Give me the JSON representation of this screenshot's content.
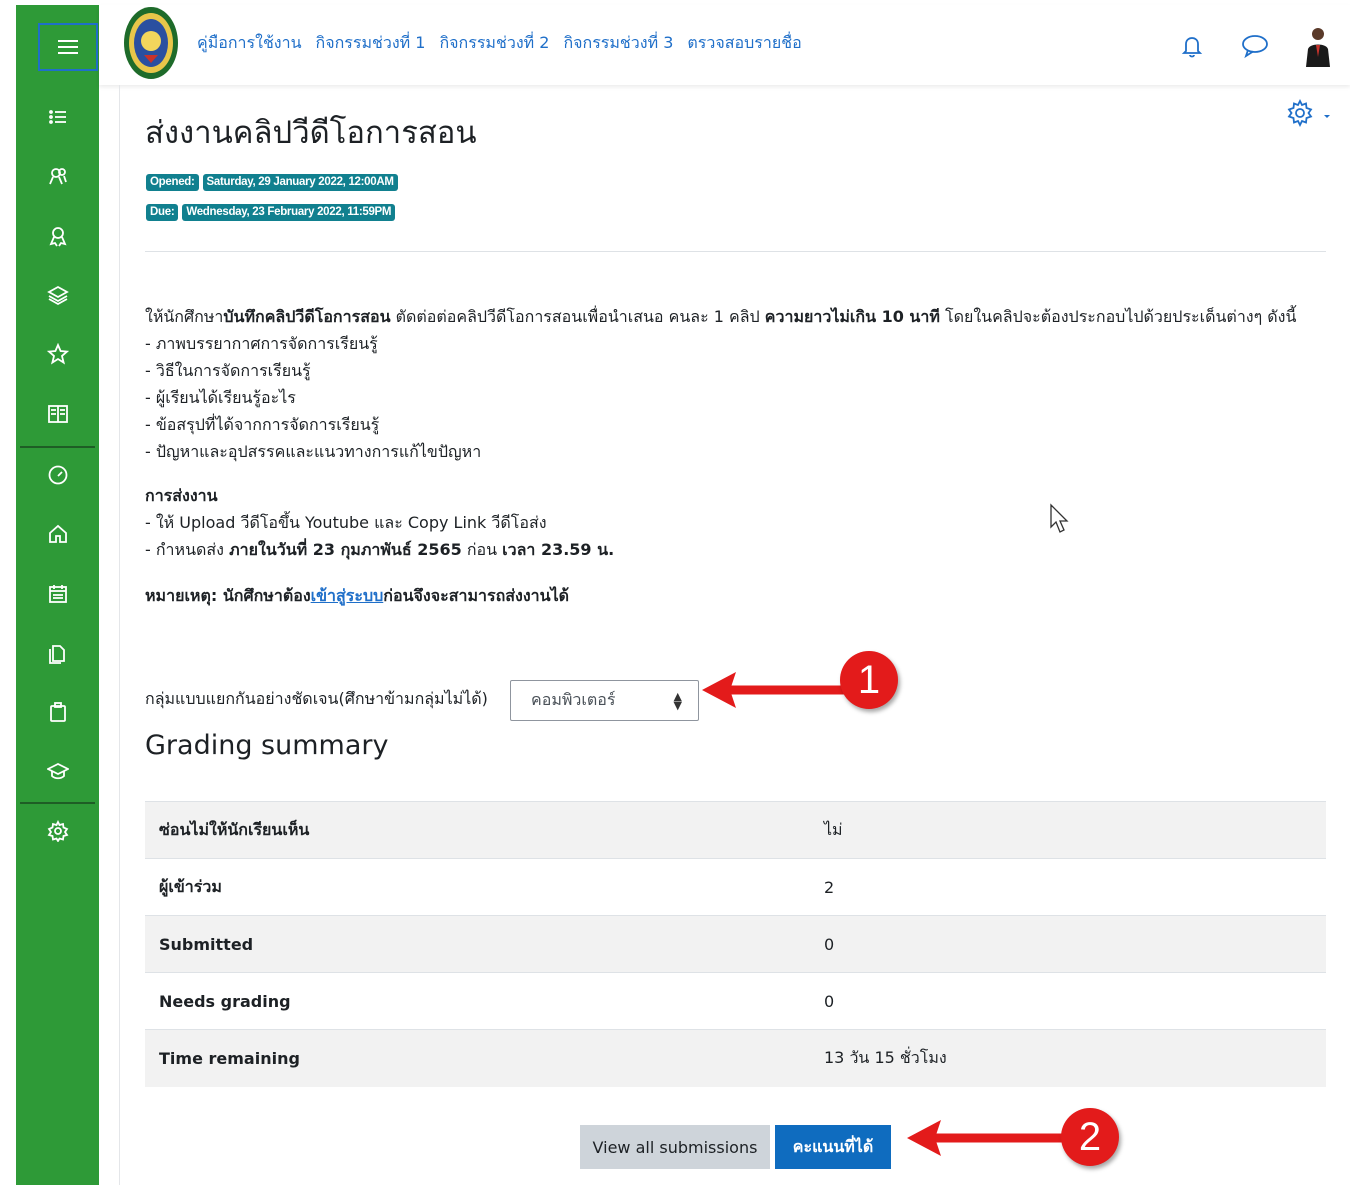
{
  "nav": {
    "menu_icon": "hamburger-icon",
    "links": [
      "คู่มือการใช้งาน",
      "กิจกรรมช่วงที่ 1",
      "กิจกรรมช่วงที่ 2",
      "กิจกรรมช่วงที่ 3",
      "ตรวจสอบรายชื่อ"
    ]
  },
  "sidebar_icons": [
    "list-icon",
    "participants-icon",
    "badges-icon",
    "competencies-icon",
    "star-icon",
    "grades-icon",
    "dashboard-icon",
    "home-icon",
    "calendar-icon",
    "files-icon",
    "content-bank-icon",
    "courses-icon",
    "settings-icon"
  ],
  "page": {
    "title": "ส่งงานคลิปวีดีโอการสอน",
    "opened_label": "Opened:",
    "opened_value": "Saturday, 29 January 2022, 12:00AM",
    "due_label": "Due:",
    "due_value": "Wednesday, 23 February 2022, 11:59PM"
  },
  "description": {
    "intro_1": "ให้นักศึกษา",
    "intro_bold_1": "บันทึกคลิปวีดีโอการสอน",
    "intro_2": " ตัดต่อต่อคลิปวีดีโอการสอนเพื่อนำเสนอ คนละ 1 คลิป ",
    "intro_bold_2": "ความยาวไม่เกิน 10 นาที",
    "intro_3": " โดยในคลิปจะต้องประกอบไปด้วยประเด็นต่างๆ ดังนี้",
    "items": [
      "- ภาพบรรยากาศการจัดการเรียนรู้",
      "- วิธีในการจัดการเรียนรู้",
      "- ผู้เรียนได้เรียนรู้อะไร",
      "- ข้อสรุปที่ได้จากการจัดการเรียนรู้",
      "- ปัญหาและอุปสรรคและแนวทางการแก้ไขปัญหา"
    ],
    "submit_heading": "การส่งงาน",
    "submit_line1": "- ให้ Upload วีดีโอขึ้น Youtube และ Copy Link วีดีโอส่ง",
    "submit_line2_a": "- กำหนดส่ง ",
    "submit_line2_b": "ภายในวันที่ 23 กุมภาพันธ์ 2565",
    "submit_line2_c": " ก่อน ",
    "submit_line2_d": "เวลา 23.59 น.",
    "note_a": "หมายเหตุ: นักศึกษาต้อง",
    "note_link": "เข้าสู่ระบบ",
    "note_b": "ก่อนจึงจะสามารถส่งงานได้"
  },
  "group": {
    "label": "กลุ่มแบบแยกกันอย่างชัดเจน(ศึกษาข้ามกลุ่มไม่ได้)",
    "selected": "คอมพิวเตอร์"
  },
  "grading": {
    "title": "Grading summary",
    "rows": [
      {
        "key": "ซ่อนไม่ให้นักเรียนเห็น",
        "value": "ไม่"
      },
      {
        "key": "ผู้เข้าร่วม",
        "value": "2"
      },
      {
        "key": "Submitted",
        "value": "0"
      },
      {
        "key": "Needs grading",
        "value": "0"
      },
      {
        "key": "Time remaining",
        "value": "13 วัน 15 ชั่วโมง"
      }
    ]
  },
  "buttons": {
    "view_all": "View all submissions",
    "grade": "คะแนนที่ได้"
  },
  "annotations": {
    "callout_1": "1",
    "callout_2": "2",
    "color": "#e31b1b"
  },
  "colors": {
    "sidebar": "#2e9a37",
    "link": "#1f6fc9",
    "badge": "#11808f",
    "primary_button": "#0f6cbf"
  }
}
